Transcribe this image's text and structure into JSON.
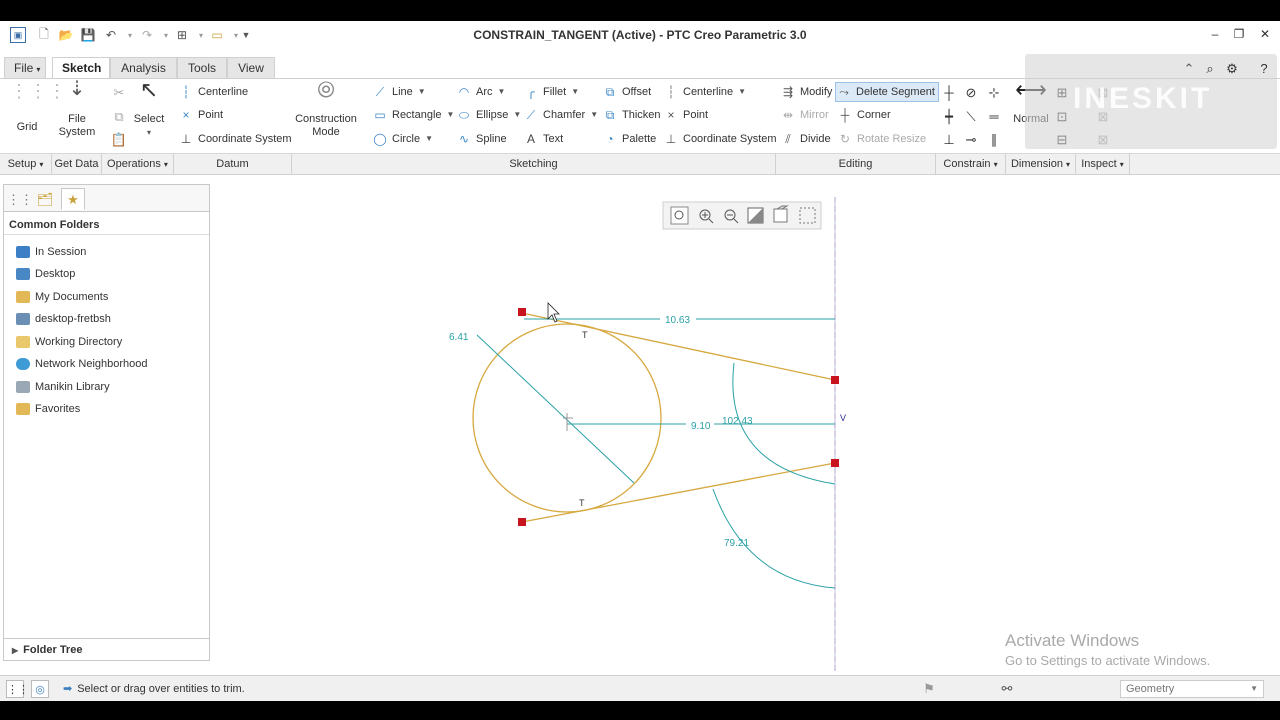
{
  "window": {
    "title": "CONSTRAIN_TANGENT (Active) - PTC Creo Parametric 3.0"
  },
  "tabs": [
    {
      "label": "File",
      "dropdown": true
    },
    {
      "label": "Sketch",
      "active": true
    },
    {
      "label": "Analysis"
    },
    {
      "label": "Tools"
    },
    {
      "label": "View"
    }
  ],
  "ribbon": {
    "setup": {
      "grid": "Grid"
    },
    "get_data": {
      "file_system": "File System"
    },
    "operations": {
      "select": "Select"
    },
    "datum": {
      "centerline": "Centerline",
      "point": "Point",
      "coordinate_system": "Coordinate System"
    },
    "construction_mode": "Construction Mode",
    "sketching": {
      "line": "Line",
      "rectangle": "Rectangle",
      "circle": "Circle",
      "arc": "Arc",
      "ellipse": "Ellipse",
      "spline": "Spline",
      "fillet": "Fillet",
      "chamfer": "Chamfer",
      "text": "Text",
      "offset": "Offset",
      "thicken": "Thicken",
      "palette": "Palette",
      "centerline": "Centerline",
      "point": "Point",
      "coordinate_system": "Coordinate System"
    },
    "editing": {
      "modify": "Modify",
      "delete_segment": "Delete Segment",
      "mirror": "Mirror",
      "corner": "Corner",
      "divide": "Divide",
      "rotate_resize": "Rotate Resize"
    },
    "dimension": {
      "normal": "Normal"
    }
  },
  "groups": [
    {
      "label": "Setup",
      "dropdown": true
    },
    {
      "label": "Get Data",
      "dropdown": false
    },
    {
      "label": "Operations",
      "dropdown": true
    },
    {
      "label": "Datum",
      "dropdown": false
    },
    {
      "label": "Sketching",
      "dropdown": false
    },
    {
      "label": "Editing",
      "dropdown": false
    },
    {
      "label": "Constrain",
      "dropdown": true
    },
    {
      "label": "Dimension",
      "dropdown": true
    },
    {
      "label": "Inspect",
      "dropdown": true
    }
  ],
  "navigator": {
    "title": "Common Folders",
    "folders": [
      "In Session",
      "Desktop",
      "My Documents",
      "desktop-fretbsh",
      "Working Directory",
      "Network Neighborhood",
      "Manikin Library",
      "Favorites"
    ],
    "folder_tree": "Folder Tree"
  },
  "sketch": {
    "dimensions": {
      "top_length": "10.63",
      "diameter": "6.41",
      "center_offset": "9.10",
      "top_angle": "102.43",
      "bottom_angle": "79.21"
    },
    "constraint_tangent": "T",
    "constraint_vertical": "V"
  },
  "status": {
    "message": "Select or drag over entities to trim.",
    "filter": "Geometry"
  },
  "watermark": {
    "line1": "Activate Windows",
    "line2": "Go to Settings to activate Windows.",
    "logo": "INESKIT"
  },
  "colors": {
    "geometry": "#d6a83e",
    "dimension": "#2aa1a6",
    "point": "#c8141e",
    "centerline": "#e0a0b0"
  }
}
